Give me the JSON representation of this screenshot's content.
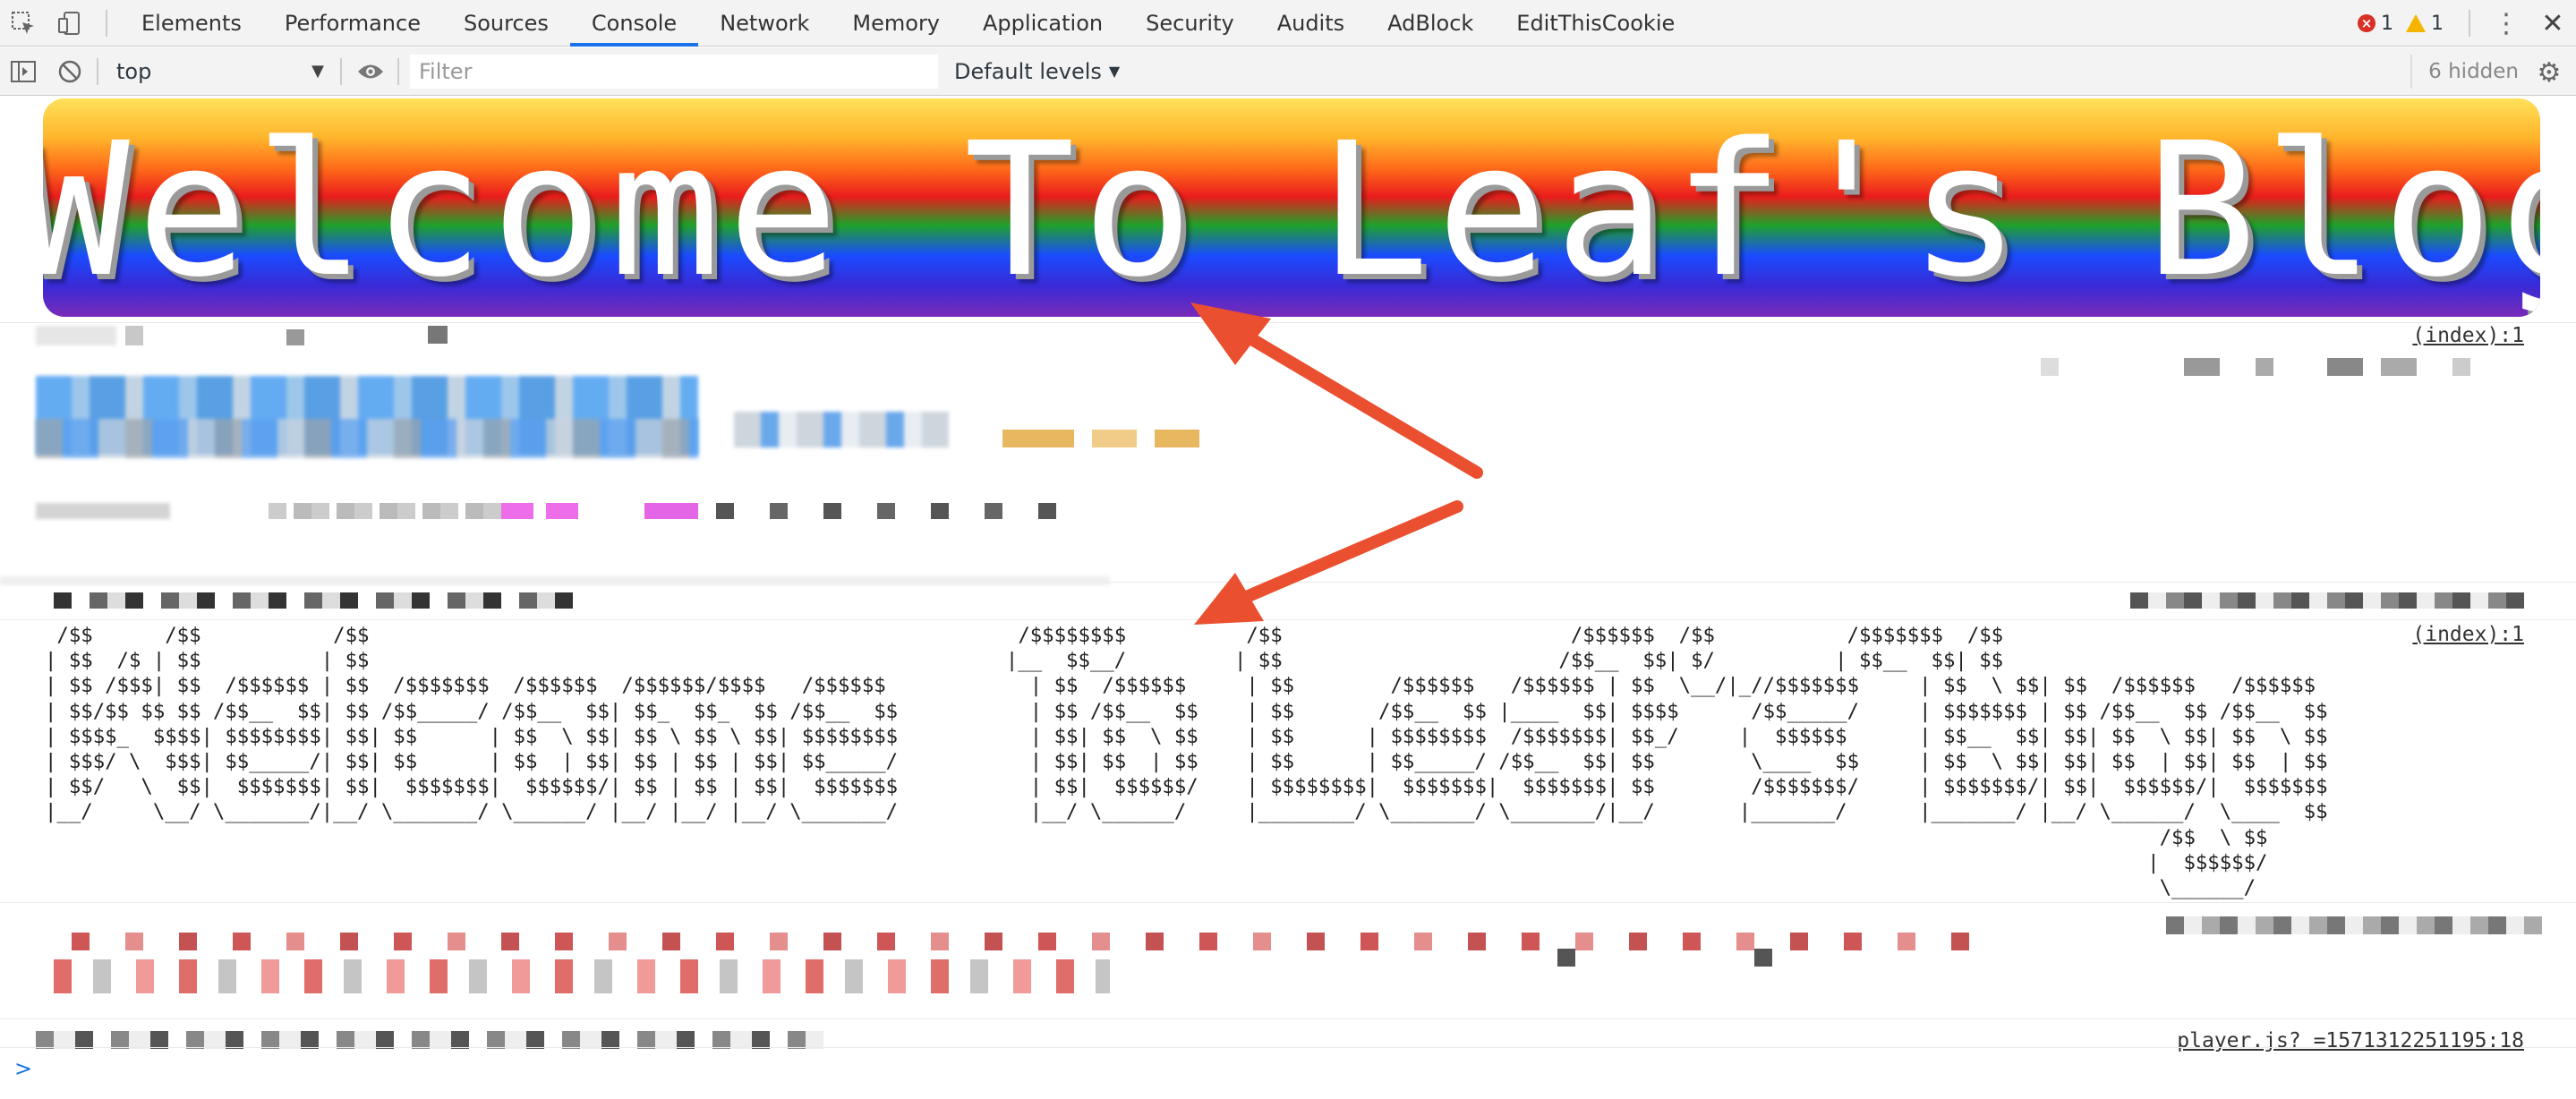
{
  "tabs": {
    "items": [
      "Elements",
      "Performance",
      "Sources",
      "Console",
      "Network",
      "Memory",
      "Application",
      "Security",
      "Audits",
      "AdBlock",
      "EditThisCookie"
    ],
    "active": "Console",
    "error_count": "1",
    "warning_count": "1"
  },
  "toolbar": {
    "context": "top",
    "filter_placeholder": "Filter",
    "levels": "Default levels",
    "hidden": "6 hidden"
  },
  "console": {
    "banner_text": "Welcome To Leaf's Blog",
    "source_index_1": "(index):1",
    "source_index_2": "(index):1",
    "source_player": "player.js? =1571312251195:18",
    "ascii_art": " /$$      /$$           /$$                                                      /$$$$$$$$          /$$                        /$$$$$$  /$$           /$$$$$$$  /$$\n| $$  /$ | $$          | $$                                                     |__  $$__/         | $$                       /$$__  $$| $/          | $$__  $$| $$\n| $$ /$$$| $$  /$$$$$$ | $$  /$$$$$$$  /$$$$$$  /$$$$$$/$$$$   /$$$$$$            | $$  /$$$$$$     | $$        /$$$$$$   /$$$$$$ | $$  \\__/|_//$$$$$$$     | $$  \\ $$| $$  /$$$$$$   /$$$$$$\n| $$/$$ $$ $$ /$$__  $$| $$ /$$_____/ /$$__  $$| $$_  $$_  $$ /$$__  $$           | $$ /$$__  $$    | $$       /$$__  $$ |____  $$| $$$$      /$$_____/     | $$$$$$$ | $$ /$$__  $$ /$$__  $$\n| $$$$_  $$$$| $$$$$$$$| $$| $$      | $$  \\ $$| $$ \\ $$ \\ $$| $$$$$$$$           | $$| $$  \\ $$    | $$      | $$$$$$$$  /$$$$$$$| $$_/     |  $$$$$$      | $$__  $$| $$| $$  \\ $$| $$  \\ $$\n| $$$/ \\  $$$| $$_____/| $$| $$      | $$  | $$| $$ | $$ | $$| $$_____/           | $$| $$  | $$    | $$      | $$_____/ /$$__  $$| $$        \\____  $$     | $$  \\ $$| $$| $$  | $$| $$  | $$\n| $$/   \\  $$|  $$$$$$$| $$|  $$$$$$$|  $$$$$$/| $$ | $$ | $$|  $$$$$$$           | $$|  $$$$$$/    | $$$$$$$$|  $$$$$$$|  $$$$$$$| $$        /$$$$$$$/     | $$$$$$$/| $$|  $$$$$$/|  $$$$$$$\n|__/     \\__/ \\_______/|__/ \\_______/ \\______/ |__/ |__/ |__/ \\_______/           |__/ \\______/     |________/ \\_______/ \\_______/|__/       |_______/      |_______/ |__/ \\______/  \\____  $$\n                                                                                                                                                                                /$$  \\ $$\n                                                                                                                                                                               |  $$$$$$/\n                                                                                                                                                                                \\______/",
    "prompt": ">"
  }
}
